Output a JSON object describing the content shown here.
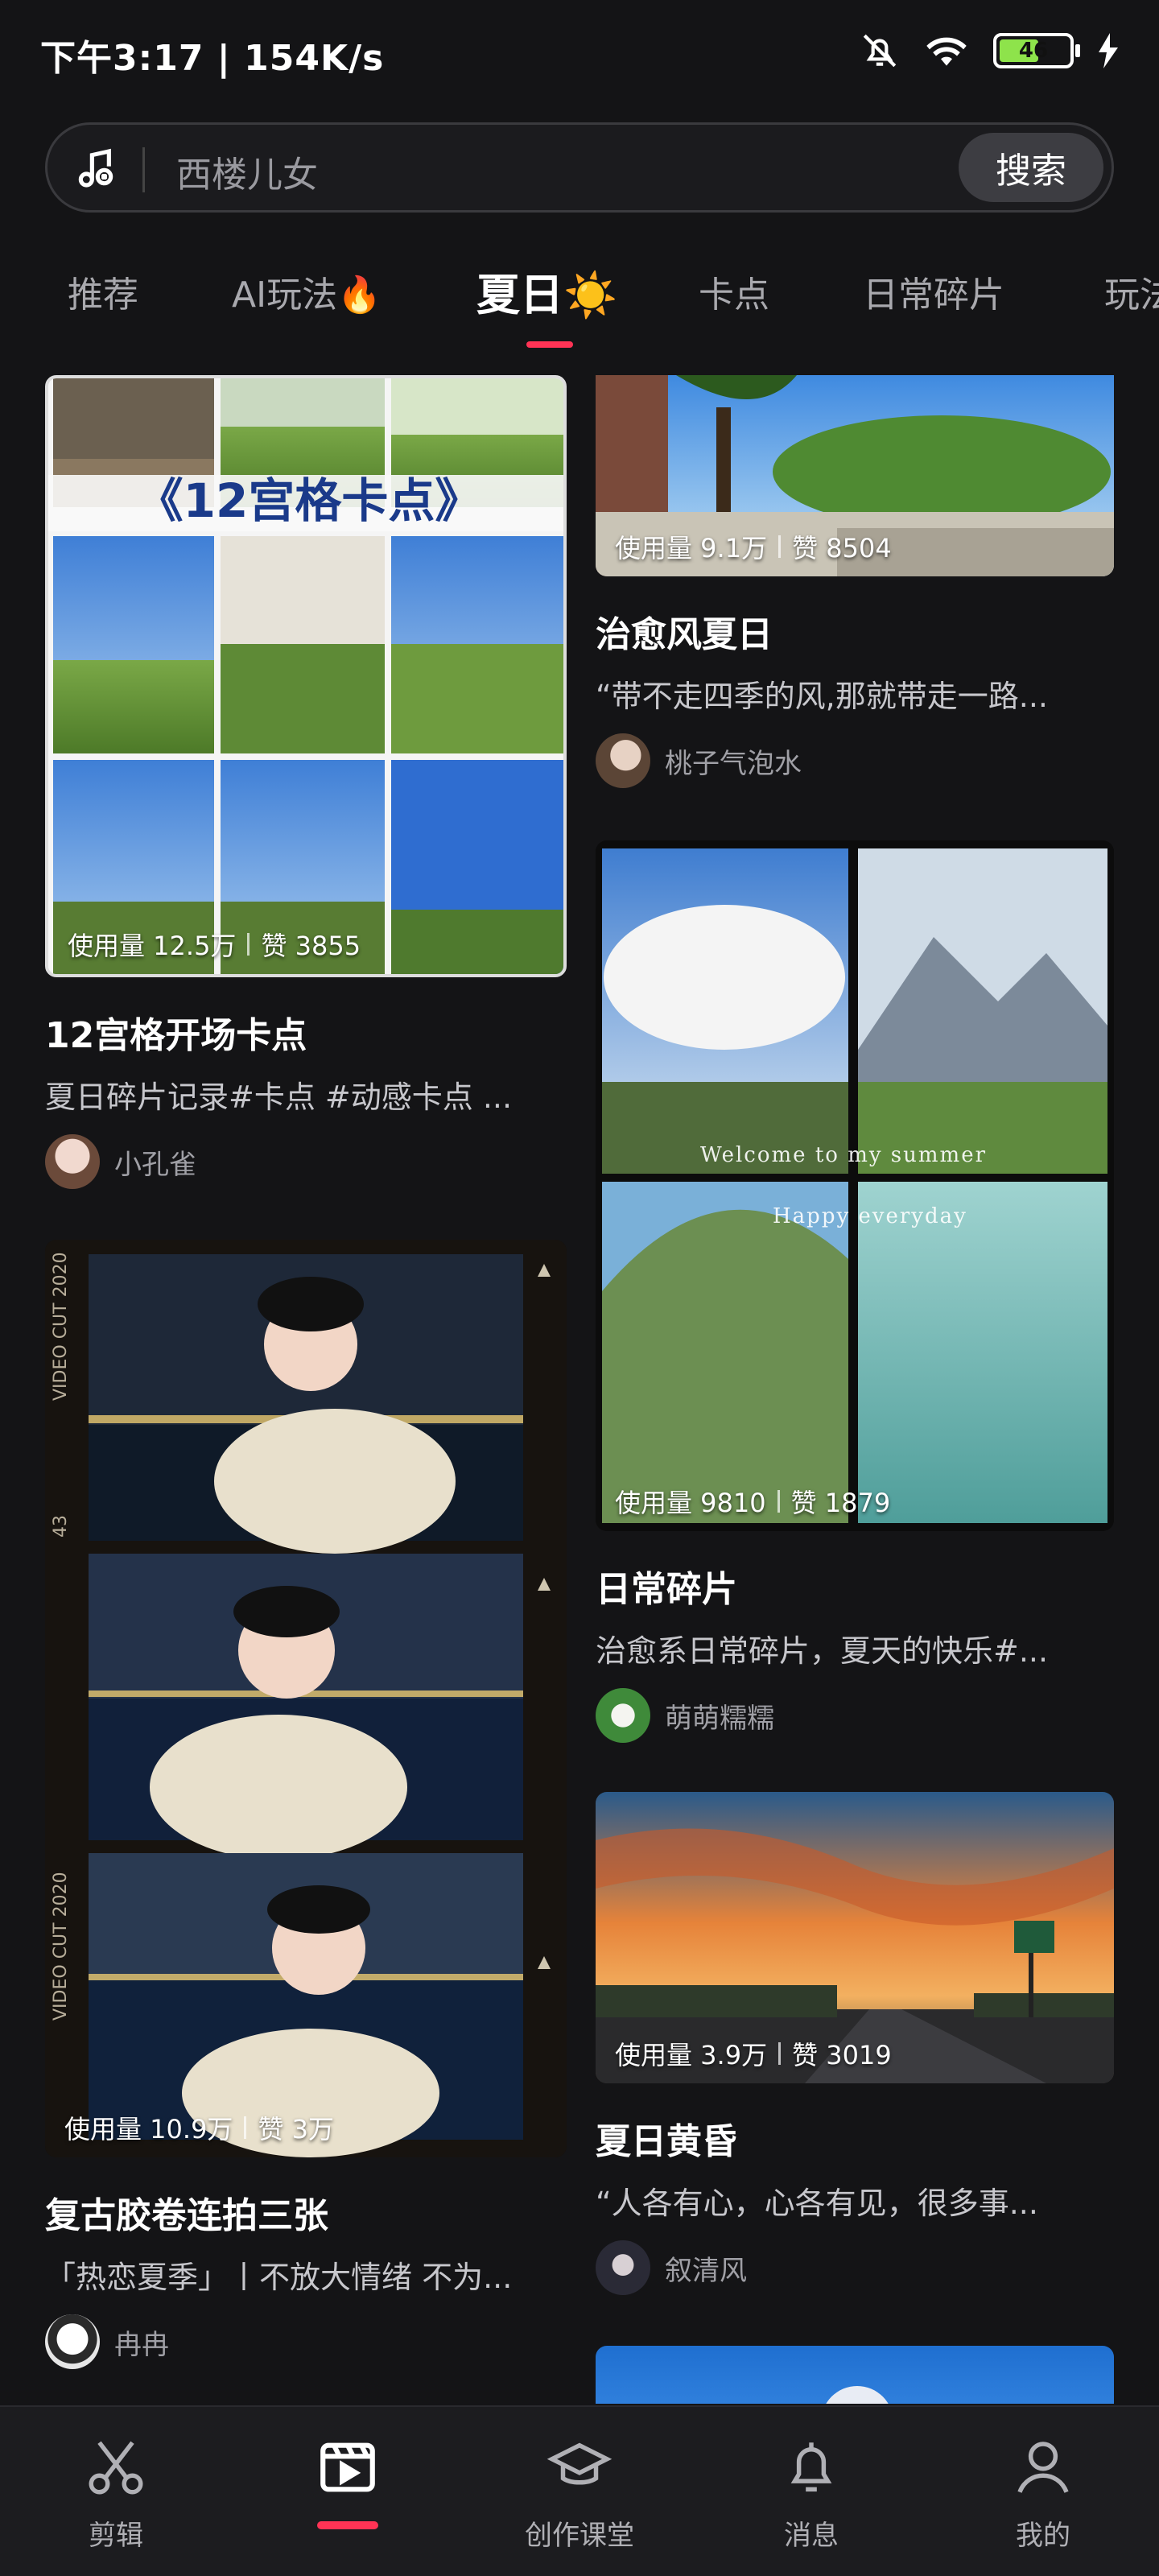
{
  "status_bar": {
    "time_speed": "下午3:17 | 154K/s",
    "battery": "46",
    "icons": [
      "bell-muted-icon",
      "wifi-icon",
      "battery-icon",
      "charging-icon"
    ]
  },
  "search": {
    "placeholder": "西楼儿女",
    "button_label": "搜索"
  },
  "tabs": [
    {
      "label": "推荐"
    },
    {
      "label": "AI玩法🔥"
    },
    {
      "label": "夏日☀️",
      "active": true
    },
    {
      "label": "卡点"
    },
    {
      "label": "日常碎片"
    },
    {
      "label": "玩法"
    }
  ],
  "cards": [
    {
      "usage": "使用量 12.5万",
      "likes": "赞 3855",
      "title": "12宫格开场卡点",
      "desc": "夏日碎片记录#卡点 #动感卡点 ...",
      "author": "小孔雀",
      "overlay": "《12宫格卡点》"
    },
    {
      "usage": "使用量 10.9万",
      "likes": "赞 3万",
      "title": "复古胶卷连拍三张",
      "desc": "「热恋夏季」丨不放大情绪 不为...",
      "author": "冉冉",
      "film_text_top": "VIDEO CUT 2020",
      "film_text_num": "43"
    },
    {
      "usage": "使用量 9.1万",
      "likes": "赞 8504",
      "title": "治愈风夏日",
      "desc": "“带不走四季的风,那就带走一路...",
      "author": "桃子气泡水"
    },
    {
      "usage": "使用量 9810",
      "likes": "赞 1879",
      "title": "日常碎片",
      "desc": "治愈系日常碎片，夏天的快乐#...",
      "author": "萌萌糯糯",
      "overlay_1": "Welcome to my summer",
      "overlay_2": "Happy everyday"
    },
    {
      "usage": "使用量 3.9万",
      "likes": "赞 3019",
      "title": "夏日黄昏",
      "desc": "“人各有心，心各有见，很多事...",
      "author": "叙清风"
    }
  ],
  "bottom_nav": [
    {
      "label": "剪辑",
      "icon": "scissors-icon"
    },
    {
      "label": "",
      "icon": "template-clapper-icon",
      "active": true
    },
    {
      "label": "创作课堂",
      "icon": "graduation-cap-icon"
    },
    {
      "label": "消息",
      "icon": "bell-icon"
    },
    {
      "label": "我的",
      "icon": "person-icon"
    }
  ],
  "colors": {
    "background": "#141416",
    "accent": "#ff3355",
    "battery_fill": "#8ee34b"
  }
}
